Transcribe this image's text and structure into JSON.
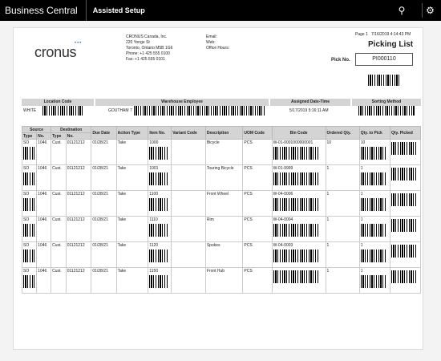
{
  "app": {
    "title": "Business Central",
    "page": "Assisted Setup"
  },
  "icons": {
    "lightbulb": "lightbulb-icon",
    "settings": "gear-icon"
  },
  "report": {
    "logo_text": "cronus",
    "company": [
      "CRONUS Canada, Inc.",
      "220 Yonge St",
      "Toronto, Ontario M5B 1G6",
      "Phone: +1 425 555 0100",
      "Fax: +1 425 555 0101"
    ],
    "contact_labels": [
      "Email:",
      "Web:",
      "Office Hours:"
    ],
    "page_label": "Page 1",
    "printed": "7/16/2019 4:14:43 PM",
    "title": "Picking List",
    "pick_no_label": "Pick No.",
    "pick_no": "PI000110",
    "header_labels": {
      "location": "Location Code",
      "employee": "Warehouse Employee",
      "assigned": "Assigned Date-Time",
      "sorting": "Sorting Method"
    },
    "header_values": {
      "location": "WHITE",
      "employee": "GOUTHAM 7",
      "assigned": "5/17/2019 5:16:11 AM",
      "sorting": ""
    },
    "group_headers": {
      "source": "Source",
      "destination": "Destination"
    },
    "columns": [
      "Type",
      "No.",
      "Type",
      "No.",
      "Due Date",
      "Action Type",
      "Item No.",
      "Variant Code",
      "Description",
      "UOM Code",
      "Bin Code",
      "Ordered Qty.",
      "Qty. to Pick",
      "Qty. Picked"
    ],
    "lines": [
      {
        "src_type": "SO",
        "src_no": "1046",
        "dst_type": "Cust.",
        "dst_no": "01121212",
        "due": "01/28/21",
        "action": "Take",
        "item": "1000",
        "variant": "",
        "desc": "Bicycle",
        "uom": "PCS",
        "bin": "W-01-0001000000001",
        "ordered": "10",
        "to_pick": "10",
        "picked": ""
      },
      {
        "src_type": "SO",
        "src_no": "1046",
        "dst_type": "Cust.",
        "dst_no": "01121212",
        "due": "01/28/21",
        "action": "Take",
        "item": "1001",
        "variant": "",
        "desc": "Touring Bicycle",
        "uom": "PCS",
        "bin": "W-01-9999",
        "ordered": "1",
        "to_pick": "1",
        "picked": ""
      },
      {
        "src_type": "SO",
        "src_no": "1046",
        "dst_type": "Cust.",
        "dst_no": "01121212",
        "due": "01/28/21",
        "action": "Take",
        "item": "1100",
        "variant": "",
        "desc": "Front Wheel",
        "uom": "PCS",
        "bin": "W-04-0006",
        "ordered": "1",
        "to_pick": "1",
        "picked": ""
      },
      {
        "src_type": "SO",
        "src_no": "1046",
        "dst_type": "Cust.",
        "dst_no": "01121212",
        "due": "01/28/21",
        "action": "Take",
        "item": "1110",
        "variant": "",
        "desc": "Rim",
        "uom": "PCS",
        "bin": "W-04-0004",
        "ordered": "1",
        "to_pick": "1",
        "picked": ""
      },
      {
        "src_type": "SO",
        "src_no": "1046",
        "dst_type": "Cust.",
        "dst_no": "01121212",
        "due": "01/28/21",
        "action": "Take",
        "item": "1120",
        "variant": "",
        "desc": "Spokes",
        "uom": "PCS",
        "bin": "W-04-0003",
        "ordered": "1",
        "to_pick": "1",
        "picked": ""
      },
      {
        "src_type": "SO",
        "src_no": "1046",
        "dst_type": "Cust.",
        "dst_no": "01121212",
        "due": "01/28/21",
        "action": "Take",
        "item": "1150",
        "variant": "",
        "desc": "Front Hub",
        "uom": "PCS",
        "bin": "",
        "ordered": "1",
        "to_pick": "1",
        "picked": ""
      }
    ]
  }
}
